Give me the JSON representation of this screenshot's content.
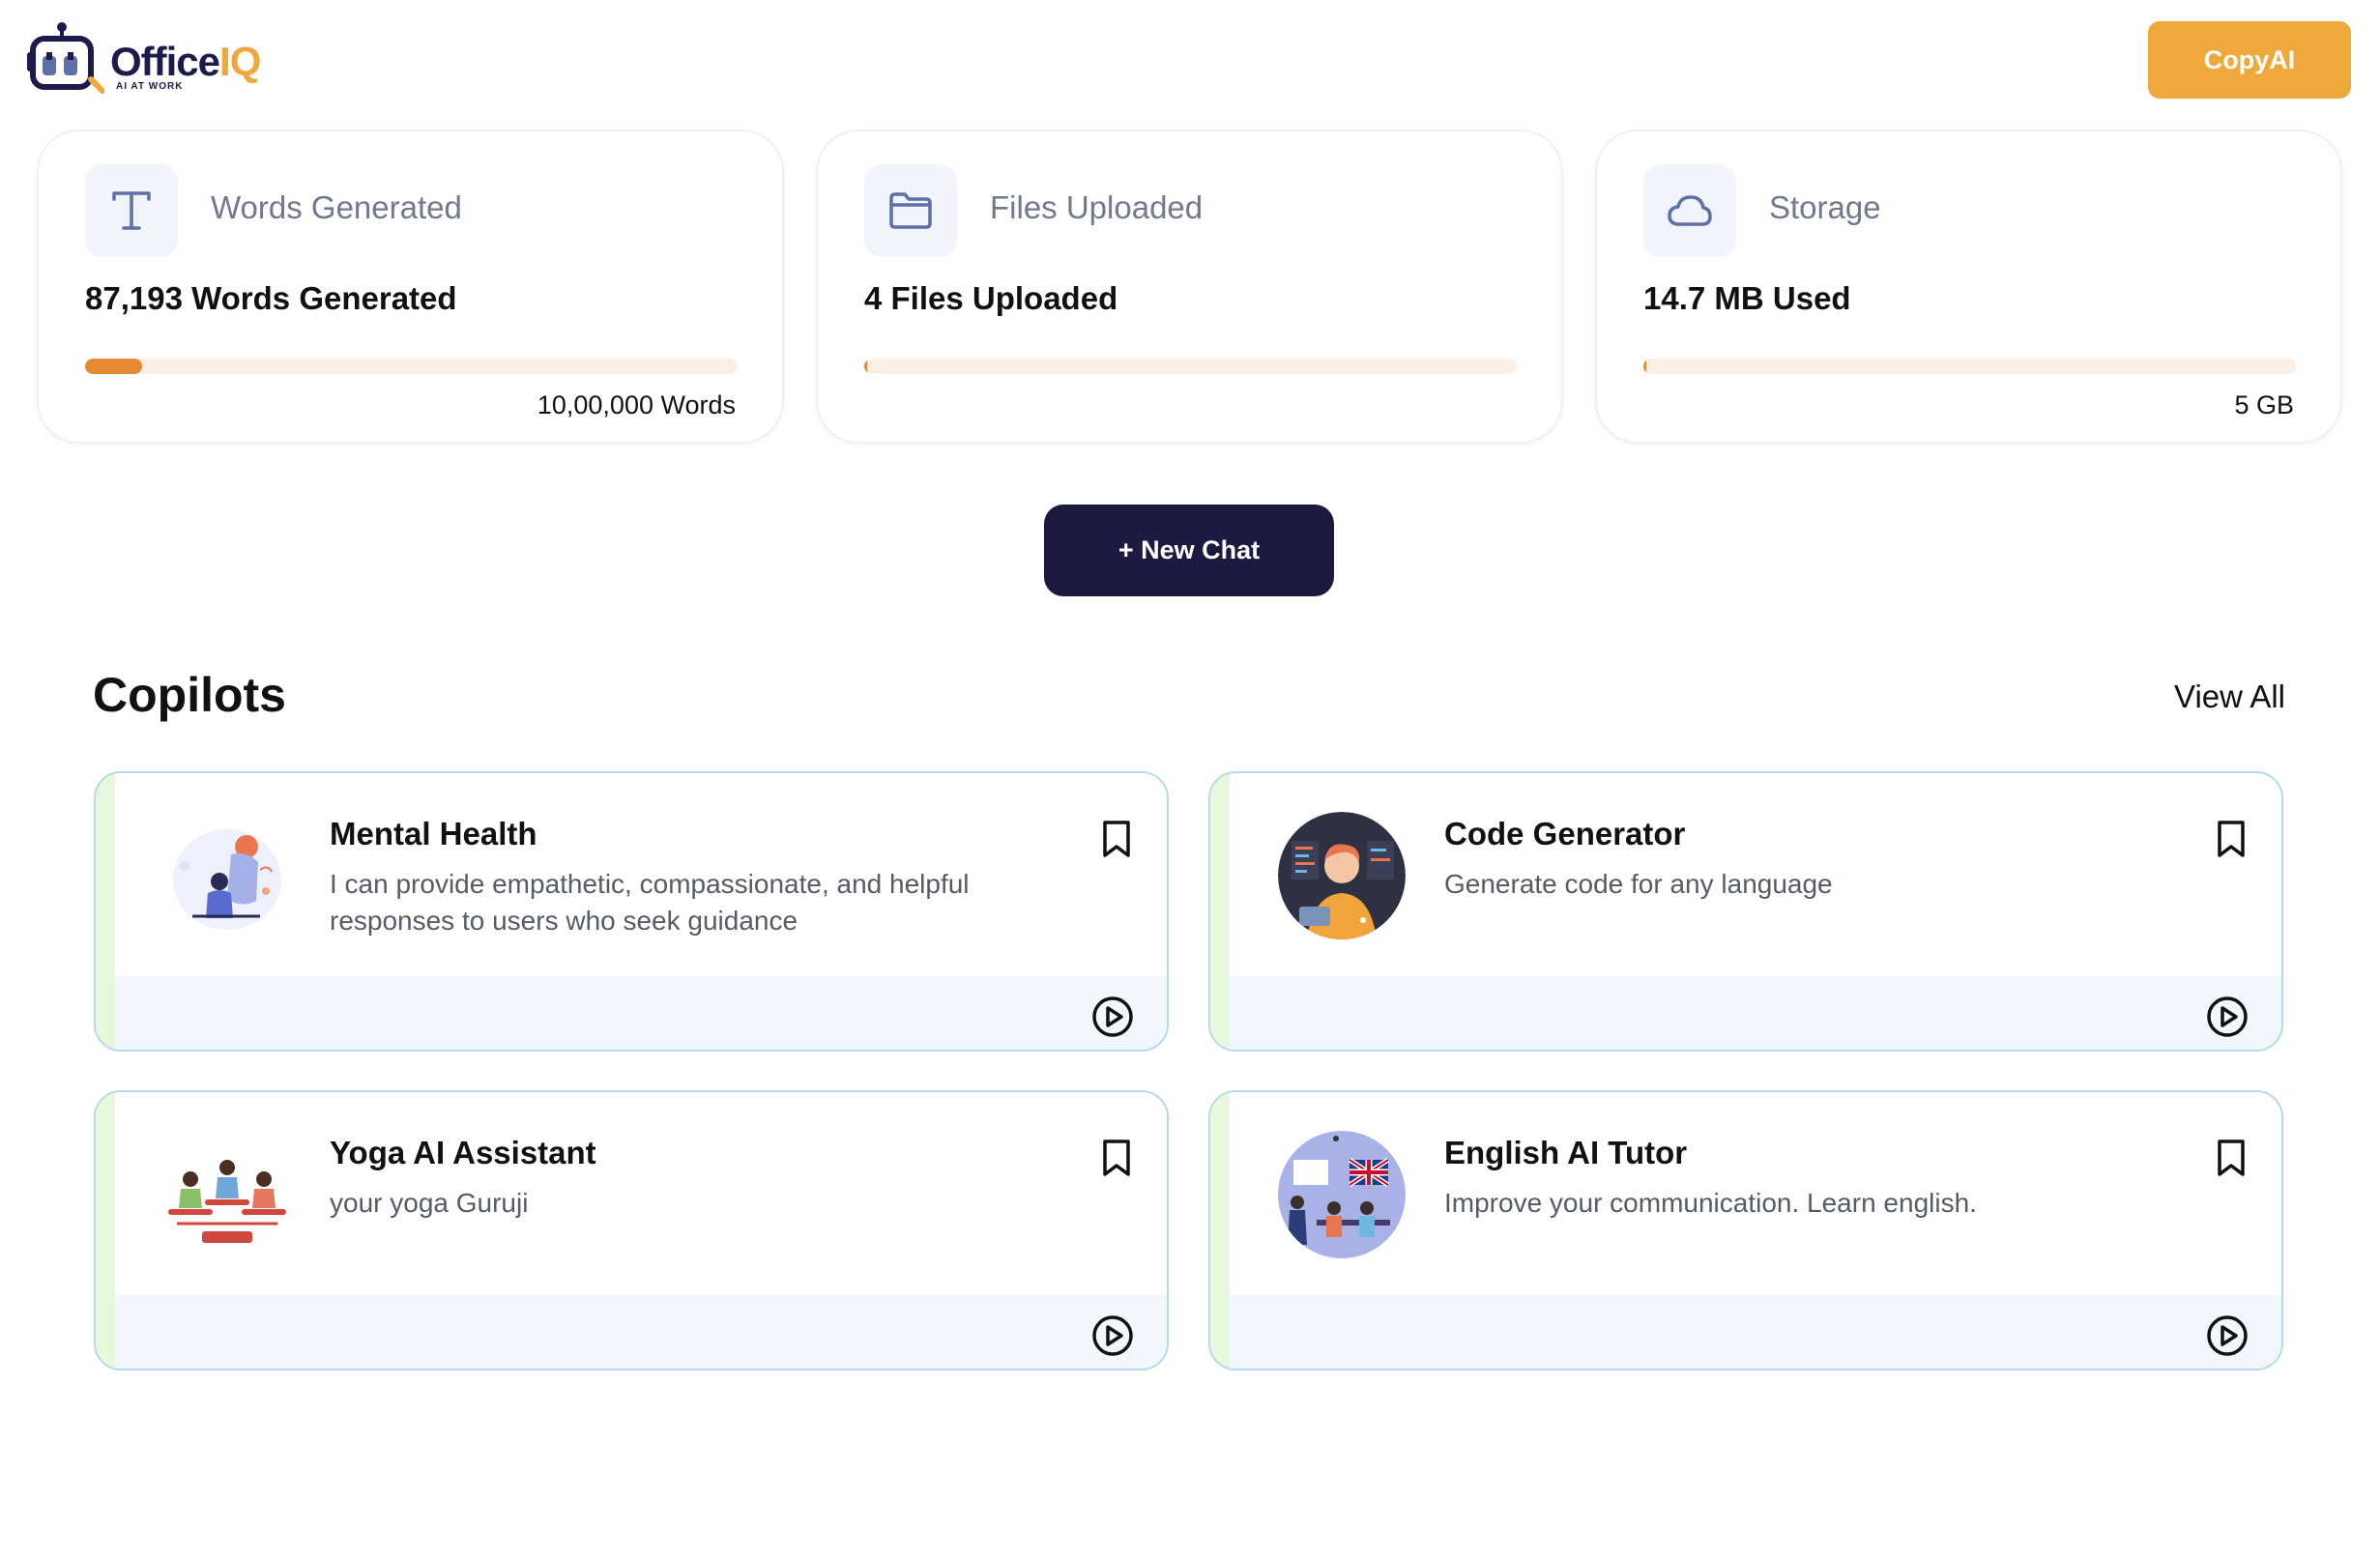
{
  "header": {
    "logo_text_main": "Office",
    "logo_text_accent": "IQ",
    "logo_tagline": "AI AT WORK",
    "copyai_label": "CopyAI"
  },
  "stats": [
    {
      "icon": "text-icon",
      "label": "Words Generated",
      "value": "87,193 Words Generated",
      "limit": "10,00,000 Words",
      "progress": 0.087
    },
    {
      "icon": "folder-icon",
      "label": "Files Uploaded",
      "value": "4 Files Uploaded",
      "limit": "",
      "progress": 0.002
    },
    {
      "icon": "cloud-icon",
      "label": "Storage",
      "value": "14.7 MB Used",
      "limit": "5 GB",
      "progress": 0.003
    }
  ],
  "new_chat_label": "+ New Chat",
  "copilots": {
    "title": "Copilots",
    "view_all_label": "View All",
    "items": [
      {
        "title": "Mental Health",
        "description": "I can provide empathetic, compassionate, and helpful responses to users who seek guidance",
        "icon": "mental-health-illustration"
      },
      {
        "title": "Code Generator",
        "description": "Generate code for any language",
        "icon": "code-generator-illustration"
      },
      {
        "title": "Yoga AI Assistant",
        "description": "your yoga Guruji",
        "icon": "yoga-illustration"
      },
      {
        "title": "English AI Tutor",
        "description": "Improve your communication. Learn english.",
        "icon": "english-tutor-illustration"
      }
    ]
  },
  "colors": {
    "accent_orange": "#eea83c",
    "progress_fill": "#e58a33",
    "dark_button": "#1c1a40",
    "card_border": "#b5d8ec"
  }
}
